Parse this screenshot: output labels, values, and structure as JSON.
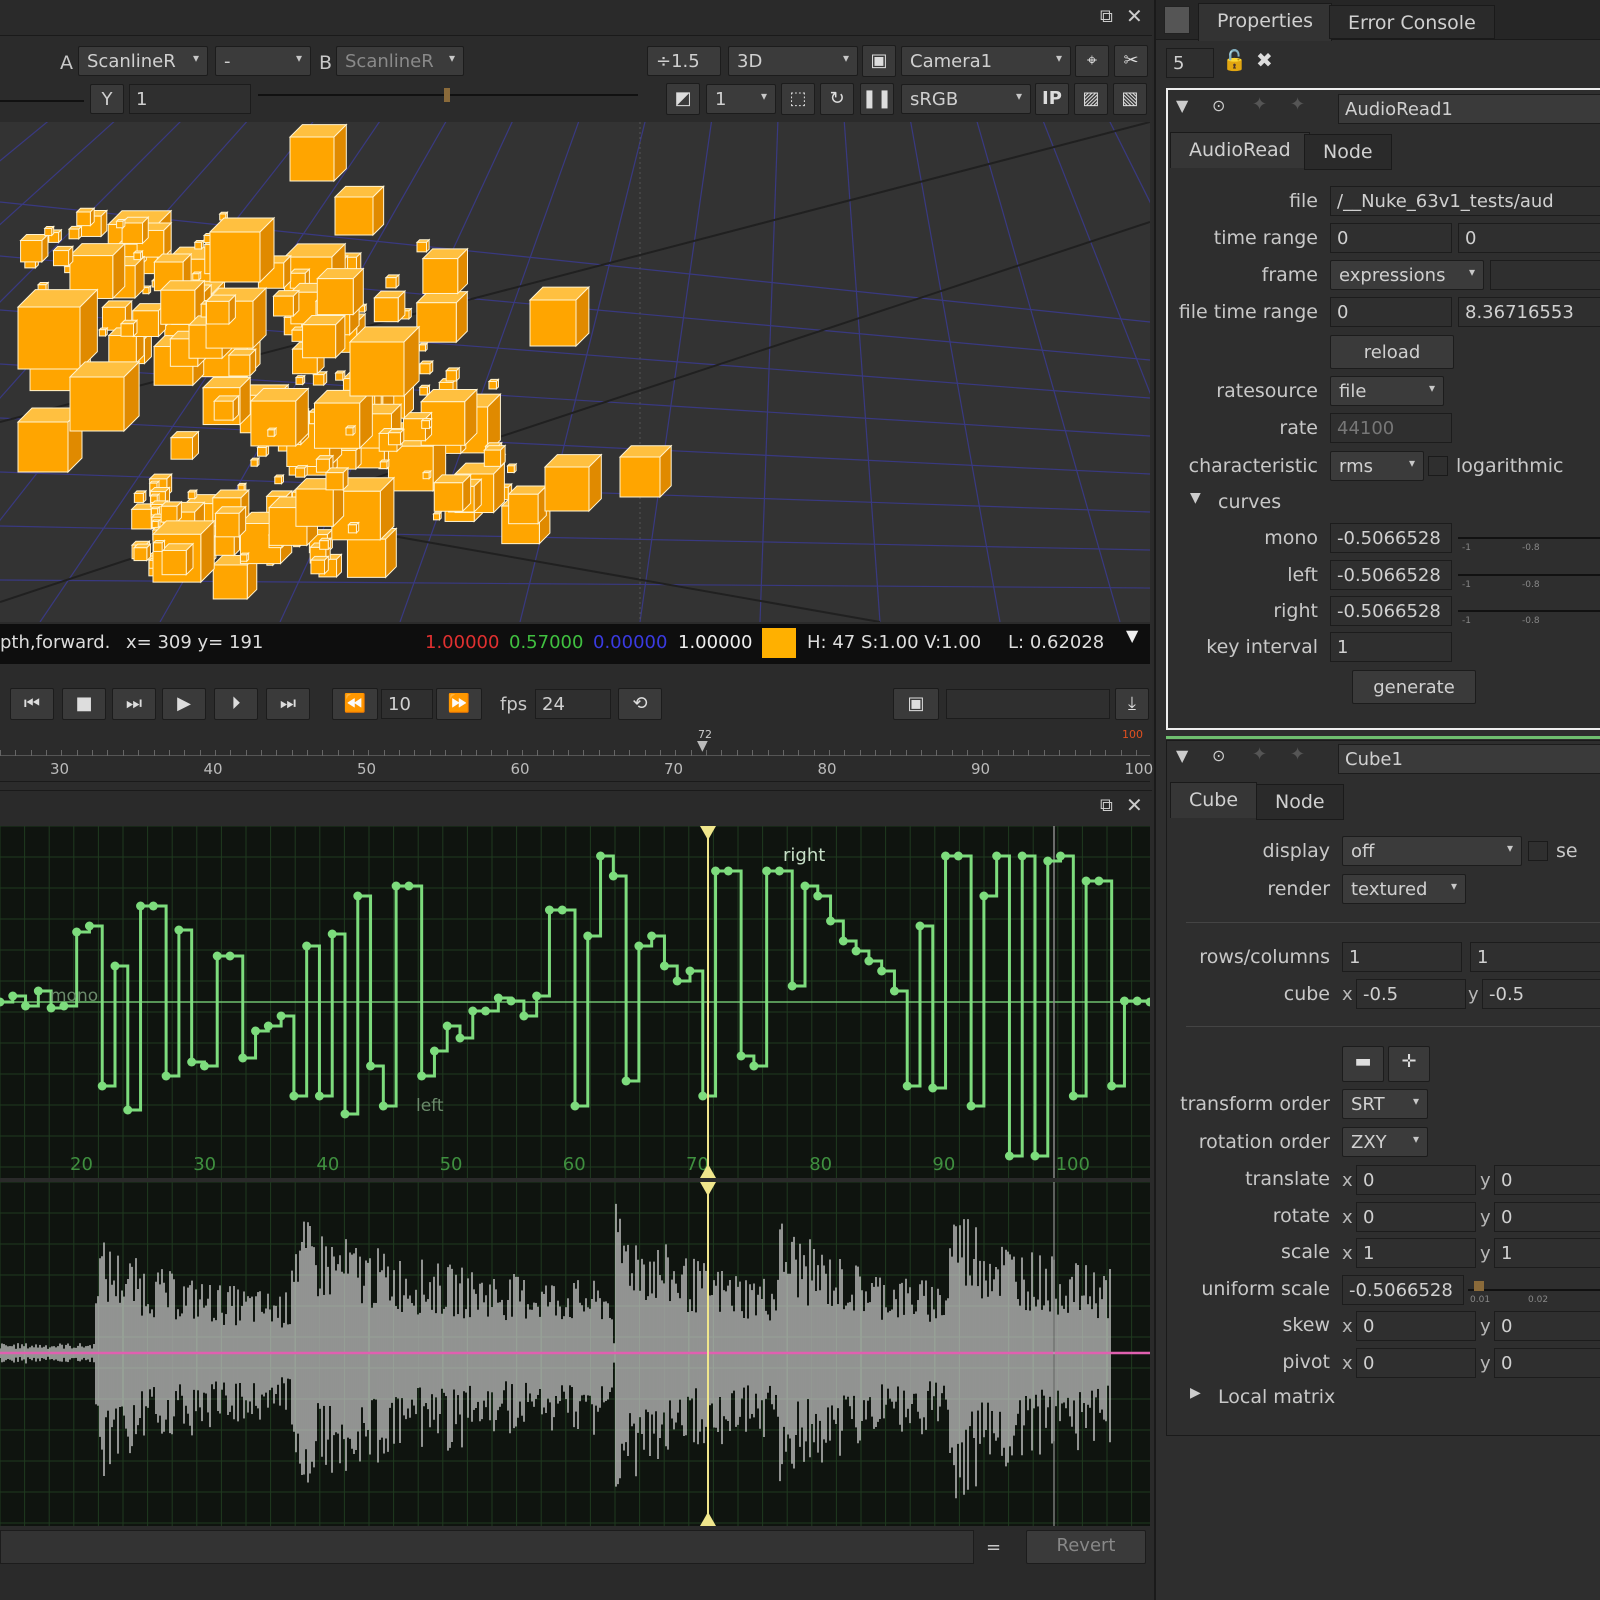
{
  "viewer": {
    "input_a_label": "A",
    "input_a": "ScanlineR",
    "input_dash": "-",
    "input_b_label": "B",
    "input_b": "ScanlineR",
    "gain": "÷1.5",
    "view_mode": "3D",
    "camera": "Camera1",
    "channel_label": "Y",
    "channel_value": "1",
    "proxy": "1",
    "colorspace": "sRGB",
    "ip_label": "IP",
    "float_icon": "window-float-icon",
    "close_icon": "close-icon"
  },
  "info_bar": {
    "layer": "pth,forward.",
    "coords": "x= 309 y= 191",
    "r": "1.00000",
    "g": "0.57000",
    "b": "0.00000",
    "a": "1.00000",
    "swatch_color": "#ffb000",
    "hsv": "H: 47 S:1.00 V:1.00",
    "lum": "L: 0.62028"
  },
  "playback": {
    "step": "10",
    "fps_label": "fps",
    "fps": "24",
    "current_frame": "72",
    "end_frame": "100",
    "ruler": [
      "30",
      "40",
      "50",
      "60",
      "70",
      "80",
      "90",
      "100"
    ]
  },
  "curve_editor": {
    "labels": {
      "mono": "mono",
      "left": "left",
      "right": "right"
    },
    "ruler": [
      "20",
      "30",
      "40",
      "50",
      "60",
      "70",
      "80",
      "90",
      "100"
    ],
    "curve_color": "#7ddc7d",
    "playhead_color": "#f0e68c"
  },
  "script_bar": {
    "equals": "=",
    "revert": "Revert"
  },
  "panel": {
    "tabs": [
      "Properties",
      "Error Console"
    ],
    "max_panels": "5"
  },
  "audioread": {
    "node_name": "AudioRead1",
    "tabs": [
      "AudioRead",
      "Node"
    ],
    "file_label": "file",
    "file": "/__Nuke_63v1_tests/aud",
    "time_range_label": "time range",
    "time_range": [
      "0",
      "0"
    ],
    "frame_label": "frame",
    "frame": "expressions",
    "file_time_range_label": "file time range",
    "file_time_range": [
      "0",
      "8.36716553"
    ],
    "reload": "reload",
    "ratesource_label": "ratesource",
    "ratesource": "file",
    "rate_label": "rate",
    "rate": "44100",
    "characteristic_label": "characteristic",
    "characteristic": "rms",
    "logarithmic": "logarithmic",
    "curves_label": "curves",
    "mono_label": "mono",
    "mono": "-0.5066528",
    "left_label": "left",
    "left": "-0.5066528",
    "right_label": "right",
    "right": "-0.5066528",
    "slider_ticks": [
      "-1",
      "-0.8"
    ],
    "key_interval_label": "key interval",
    "key_interval": "1",
    "generate": "generate"
  },
  "cube": {
    "node_name": "Cube1",
    "tabs": [
      "Cube",
      "Node"
    ],
    "display_label": "display",
    "display": "off",
    "selectable": "se",
    "render_label": "render",
    "render": "textured",
    "rows_columns_label": "rows/columns",
    "rows_columns": [
      "1",
      "1"
    ],
    "cube_label": "cube",
    "cube_x": "-0.5",
    "cube_y": "-0.5",
    "transform_order_label": "transform order",
    "transform_order": "SRT",
    "rotation_order_label": "rotation order",
    "rotation_order": "ZXY",
    "translate_label": "translate",
    "translate": [
      "0",
      "0"
    ],
    "rotate_label": "rotate",
    "rotate": [
      "0",
      "0"
    ],
    "scale_label": "scale",
    "scale": [
      "1",
      "1"
    ],
    "uniform_scale_label": "uniform scale",
    "uniform_scale": "-0.5066528",
    "uniform_ticks": [
      "0.01",
      "0.02"
    ],
    "skew_label": "skew",
    "skew": [
      "0",
      "0"
    ],
    "pivot_label": "pivot",
    "pivot": [
      "0",
      "0"
    ],
    "local_matrix": "Local matrix",
    "x_axis": "x",
    "y_axis": "y"
  },
  "colors": {
    "cube_fill": "#ffa500",
    "waveform": "#d8d8d8",
    "zero_line": "#e060b0",
    "node_active": "#6fbf6f"
  }
}
